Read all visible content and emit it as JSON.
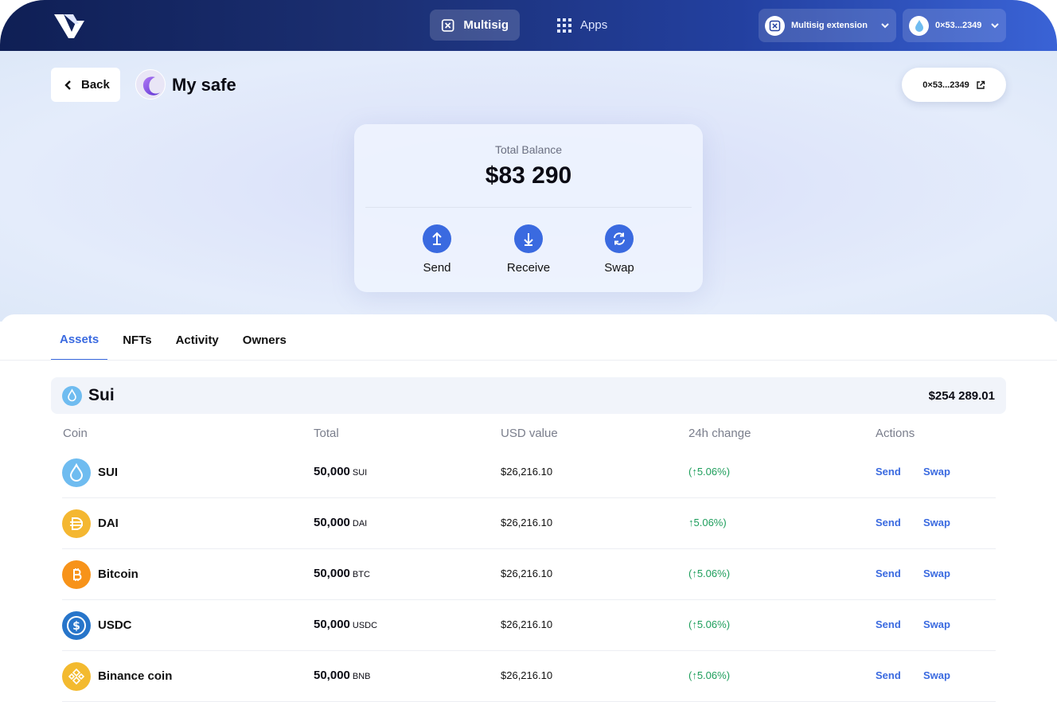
{
  "nav": {
    "tabs": [
      {
        "label": "Multisig",
        "icon": "multisig-icon"
      },
      {
        "label": "Apps",
        "icon": "grid-icon"
      }
    ],
    "extension_label": "Multisig extension",
    "account_label": "0×53...2349"
  },
  "header": {
    "back_label": "Back",
    "safe_name": "My safe",
    "address": "0×53...2349"
  },
  "balance": {
    "label": "Total Balance",
    "value": "$83 290",
    "actions": [
      {
        "label": "Send",
        "icon": "arrow-up-icon"
      },
      {
        "label": "Receive",
        "icon": "arrow-down-icon"
      },
      {
        "label": "Swap",
        "icon": "refresh-icon"
      }
    ]
  },
  "tabs": [
    "Assets",
    "NFTs",
    "Activity",
    "Owners"
  ],
  "active_tab": "Assets",
  "chain": {
    "name": "Sui",
    "total": "$254 289.01"
  },
  "columns": [
    "Coin",
    "Total",
    "USD value",
    "24h change",
    "Actions"
  ],
  "rows": [
    {
      "name": "SUI",
      "amount": "50,000",
      "unit": "SUI",
      "usd": "$26,216.10",
      "change": "(↑5.06%)",
      "send": "Send",
      "swap": "Swap",
      "color": "#6fbcf0",
      "icon": "sui-icon"
    },
    {
      "name": "DAI",
      "amount": "50,000",
      "unit": "DAI",
      "usd": "$26,216.10",
      "change": "↑5.06%)",
      "send": "Send",
      "swap": "Swap",
      "color": "#f4b731",
      "icon": "dai-icon"
    },
    {
      "name": "Bitcoin",
      "amount": "50,000",
      "unit": "BTC",
      "usd": "$26,216.10",
      "change": "(↑5.06%)",
      "send": "Send",
      "swap": "Swap",
      "color": "#f7931a",
      "icon": "bitcoin-icon"
    },
    {
      "name": "USDC",
      "amount": "50,000",
      "unit": "USDC",
      "usd": "$26,216.10",
      "change": "(↑5.06%)",
      "send": "Send",
      "swap": "Swap",
      "color": "#2775ca",
      "icon": "usdc-icon"
    },
    {
      "name": "Binance coin",
      "amount": "50,000",
      "unit": "BNB",
      "usd": "$26,216.10",
      "change": "(↑5.06%)",
      "send": "Send",
      "swap": "Swap",
      "color": "#f3ba2f",
      "icon": "bnb-icon"
    }
  ],
  "colors": {
    "accent": "#3a6ae0",
    "positive": "#1e9e5c"
  }
}
